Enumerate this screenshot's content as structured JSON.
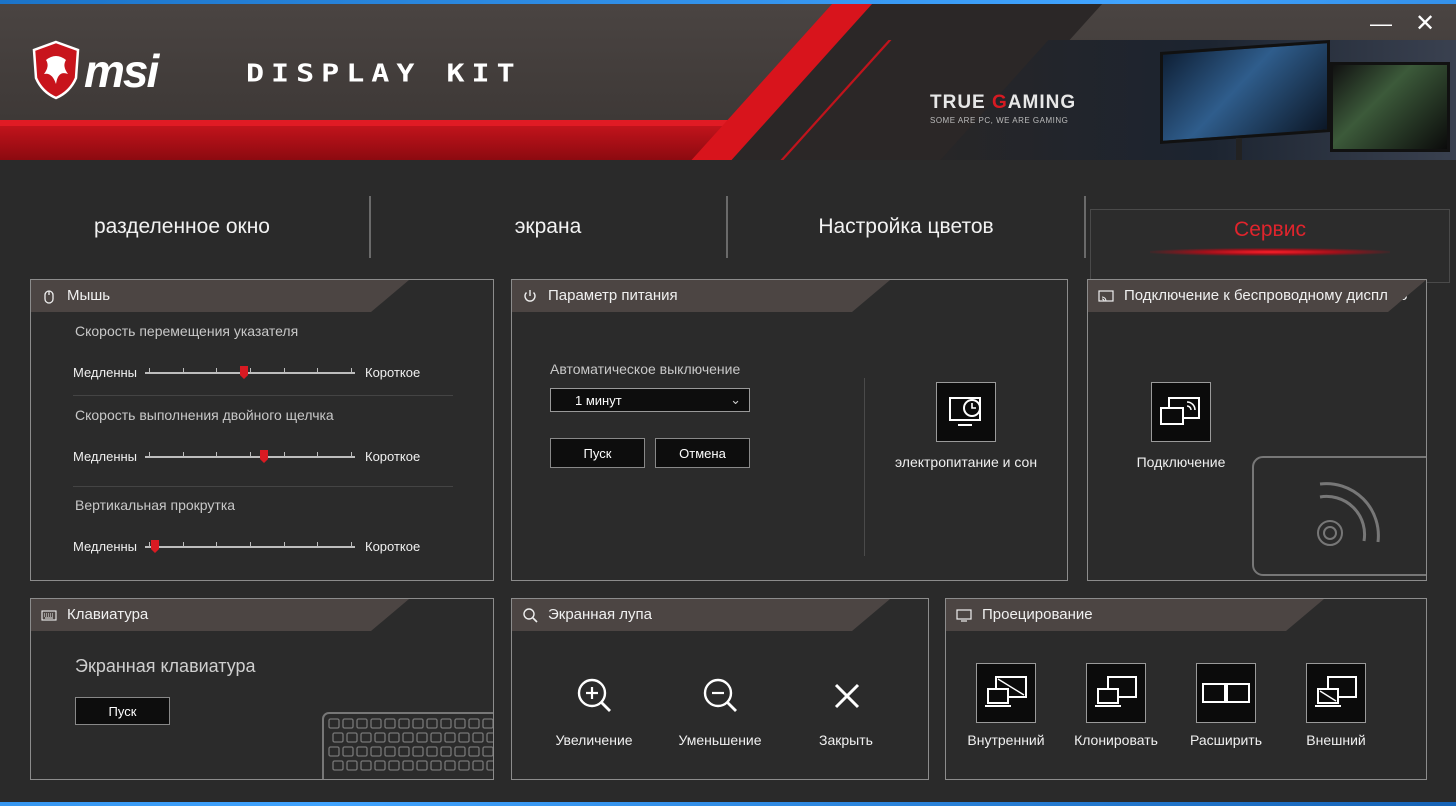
{
  "app": {
    "brand": "msi",
    "product": "DISPLAY KIT",
    "banner_title_pre": "TRUE ",
    "banner_title_g": "G",
    "banner_title_post": "AMING",
    "banner_subtitle": "SOME ARE PC, WE ARE GAMING",
    "minimize_glyph": "—",
    "close_glyph": "✕"
  },
  "tabs": [
    {
      "label": "разделенное окно"
    },
    {
      "label": "экрана"
    },
    {
      "label": "Настройка цветов"
    },
    {
      "label": "Сервис",
      "active": true
    }
  ],
  "mouse": {
    "title": "Мышь",
    "pointer_speed": {
      "label": "Скорость перемещения указателя",
      "min_label": "Медленны",
      "max_label": "Короткое",
      "value": 0.47
    },
    "double_click": {
      "label": "Скорость выполнения двойного щелчка",
      "min_label": "Медленны",
      "max_label": "Короткое",
      "value": 0.57
    },
    "vertical_scroll": {
      "label": "Вертикальная прокрутка",
      "min_label": "Медленны",
      "max_label": "Короткое",
      "value": 0.03
    }
  },
  "power": {
    "title": "Параметр питания",
    "auto_off_label": "Автоматическое выключение",
    "auto_off_value": "1 минут",
    "start_button": "Пуск",
    "cancel_button": "Отмена",
    "power_sleep_label": "электропитание и сон"
  },
  "wireless": {
    "title": "Подключение к беспроводному дисплею",
    "connect_label": "Подключение"
  },
  "keyboard": {
    "title": "Клавиатура",
    "osk_label": "Экранная клавиатура",
    "start_button": "Пуск"
  },
  "magnifier": {
    "title": "Экранная лупа",
    "zoom_in_label": "Увеличение",
    "zoom_out_label": "Уменьшение",
    "close_label": "Закрыть"
  },
  "projection": {
    "title": "Проецирование",
    "items": [
      {
        "label": "Внутренний"
      },
      {
        "label": "Клонировать"
      },
      {
        "label": "Расширить"
      },
      {
        "label": "Внешний"
      }
    ]
  },
  "colors": {
    "accent": "#d81a22",
    "panel_head": "#4c4543",
    "background": "#2a2a2a"
  }
}
